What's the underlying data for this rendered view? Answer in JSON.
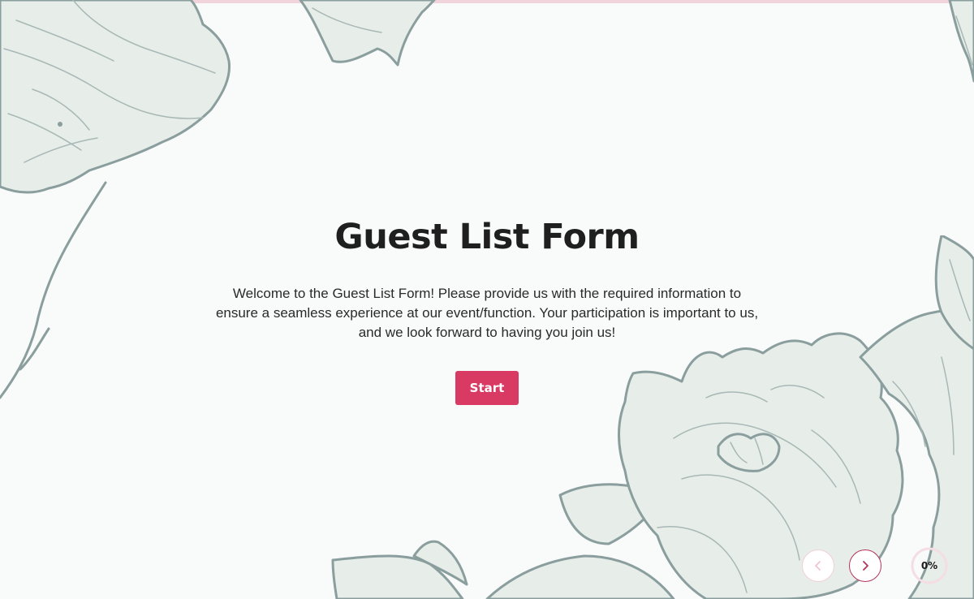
{
  "form": {
    "title": "Guest List Form",
    "description": "Welcome to the Guest List Form! Please provide us with the required information to ensure a seamless experience at our event/function. Your participation is important to us, and we look forward to having you join us!",
    "start_label": "Start"
  },
  "navigation": {
    "previous_icon": "chevron-left-icon",
    "next_icon": "chevron-right-icon"
  },
  "progress": {
    "label": "0%",
    "value": 0
  },
  "colors": {
    "accent": "#d93a63",
    "top_bar": "#f1d3dc",
    "illustration_fill": "#e7ede9",
    "illustration_stroke": "#8a9e9d"
  }
}
